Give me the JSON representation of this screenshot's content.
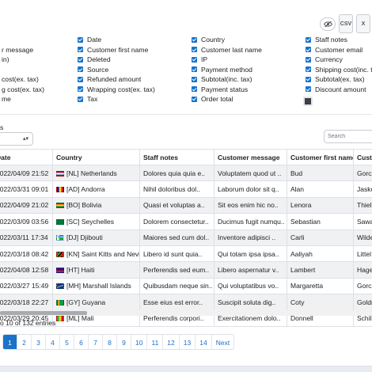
{
  "toolbar": {
    "visibility_icon": "eye-slash-icon",
    "csv_label": "CSV",
    "excel_label": "X"
  },
  "column_toggles": [
    {
      "label": "Date",
      "checked": true
    },
    {
      "label": "Country",
      "checked": true
    },
    {
      "label": "Staff notes",
      "checked": true
    },
    {
      "label": "r message",
      "checked": true
    },
    {
      "label": "Customer first name",
      "checked": true
    },
    {
      "label": "Customer last name",
      "checked": true
    },
    {
      "label": "Customer email",
      "checked": true
    },
    {
      "label": "in)",
      "checked": true
    },
    {
      "label": "Deleted",
      "checked": true
    },
    {
      "label": "IP",
      "checked": true
    },
    {
      "label": "Currency",
      "checked": true
    },
    {
      "label": "Source",
      "checked": true
    },
    {
      "label": "Payment method",
      "checked": true
    },
    {
      "label": "Shipping cost(inc. tax)",
      "checked": true
    },
    {
      "label": "cost(ex. tax)",
      "checked": true
    },
    {
      "label": "Refunded amount",
      "checked": true
    },
    {
      "label": "Subtotal(inc. tax)",
      "checked": true
    },
    {
      "label": "Subtotal(ex. tax)",
      "checked": true
    },
    {
      "label": "g cost(ex. tax)",
      "checked": true
    },
    {
      "label": "Wrapping cost(ex. tax)",
      "checked": true
    },
    {
      "label": "Payment status",
      "checked": true
    },
    {
      "label": "Discount amount",
      "checked": true
    },
    {
      "label": "me",
      "checked": true
    },
    {
      "label": "Tax",
      "checked": true
    },
    {
      "label": "Order total",
      "checked": true
    }
  ],
  "length": {
    "label": "s",
    "value": ""
  },
  "search": {
    "placeholder": "Search"
  },
  "table": {
    "headers": [
      "Date",
      "Country",
      "Staff notes",
      "Customer message",
      "Customer first name",
      "Custo"
    ],
    "rows": [
      {
        "date": "2022/04/09 21:52",
        "flag": "NL",
        "country": "[NL] Netherlands",
        "staff": "Dolores quia quia e..",
        "message": "Voluptatem quod ut ..",
        "first": "Bud",
        "last": "Gorcz"
      },
      {
        "date": "2022/03/31 09:01",
        "flag": "AD",
        "country": "[AD] Andorra",
        "staff": "Nihil doloribus dol..",
        "message": "Laborum dolor sit q..",
        "first": "Alan",
        "last": "Jasko"
      },
      {
        "date": "2022/04/09 21:02",
        "flag": "BO",
        "country": "[BO] Bolivia",
        "staff": "Quasi et voluptas a..",
        "message": "Sit eos enim hic no..",
        "first": "Lenora",
        "last": "Thiel"
      },
      {
        "date": "2022/03/09 03:56",
        "flag": "SC",
        "country": "[SC] Seychelles",
        "staff": "Dolorem consectetur..",
        "message": "Ducimus fugit numqu..",
        "first": "Sebastian",
        "last": "Sawa"
      },
      {
        "date": "2022/03/11 17:34",
        "flag": "DJ",
        "country": "[DJ] Djibouti",
        "staff": "Maiores sed cum dol..",
        "message": "Inventore adipisci ..",
        "first": "Carli",
        "last": "Wilde"
      },
      {
        "date": "2022/03/18 08:42",
        "flag": "KN",
        "country": "[KN] Saint Kitts and Nevis",
        "staff": "Libero id sunt quia..",
        "message": "Qui totam ipsa ipsa..",
        "first": "Aaliyah",
        "last": "Littel"
      },
      {
        "date": "2022/04/08 12:58",
        "flag": "HT",
        "country": "[HT] Haiti",
        "staff": "Perferendis sed eum..",
        "message": "Libero aspernatur v..",
        "first": "Lambert",
        "last": "Hage"
      },
      {
        "date": "2022/03/27 15:49",
        "flag": "MH",
        "country": "[MH] Marshall Islands",
        "staff": "Quibusdam neque sin..",
        "message": "Qui voluptatibus vo..",
        "first": "Margaretta",
        "last": "Gorcz"
      },
      {
        "date": "2022/03/18 22:27",
        "flag": "GY",
        "country": "[GY] Guyana",
        "staff": "Esse eius est error..",
        "message": "Suscipit soluta dig..",
        "first": "Coty",
        "last": "Goldn"
      },
      {
        "date": "2022/03/29 20:45",
        "flag": "ML",
        "country": "[ML] Mali",
        "staff": "Perferendis corpori..",
        "message": "Exercitationem dolo..",
        "first": "Donnell",
        "last": "Schill"
      }
    ]
  },
  "info": "o 10 of 132 entries",
  "pagination": {
    "pages": [
      "1",
      "2",
      "3",
      "4",
      "5",
      "6",
      "7",
      "8",
      "9",
      "10",
      "11",
      "12",
      "13",
      "14"
    ],
    "active": "1",
    "next_label": "Next"
  },
  "colors": {
    "accent": "#1a73c9",
    "row_stripe": "#f0f1f3"
  }
}
